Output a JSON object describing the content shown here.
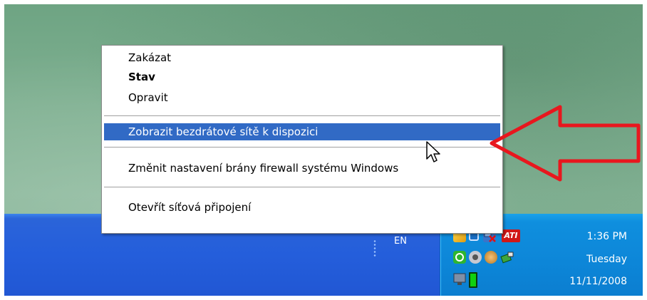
{
  "menu": {
    "items": [
      {
        "label": "Zakázat",
        "bold": false,
        "selected": false
      },
      {
        "label": "Stav",
        "bold": true,
        "selected": false
      },
      {
        "label": "Opravit",
        "bold": false,
        "selected": false
      },
      {
        "label": "Zobrazit bezdrátové sítě k dispozici",
        "bold": false,
        "selected": true
      },
      {
        "label": "Změnit nastavení brány firewall systému Windows",
        "bold": false,
        "selected": false
      },
      {
        "label": "Otevřít síťová připojení",
        "bold": false,
        "selected": false
      }
    ]
  },
  "taskbar": {
    "language": "EN"
  },
  "tray": {
    "clock": {
      "time": "1:36 PM",
      "day": "Tuesday",
      "date": "11/11/2008"
    },
    "icons": [
      "network-status-icon",
      "network-disconnected-icon",
      "ati-icon",
      "nvidia-icon",
      "volume-icon",
      "antivirus-icon",
      "wireless-icon",
      "network-connection-icon",
      "battery-icon"
    ],
    "ati_label": "ATI"
  },
  "colors": {
    "selection": "#316ac5",
    "taskbar": "#245edb",
    "tray": "#0f8fde",
    "annotation_arrow": "#e8171e"
  }
}
